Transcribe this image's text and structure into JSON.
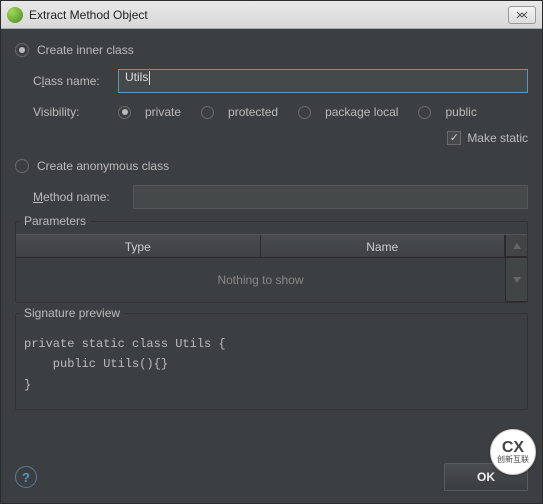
{
  "window": {
    "title": "Extract Method Object"
  },
  "opt_inner": {
    "label": "Create inner class",
    "selected": true
  },
  "class_name": {
    "label_pre": "C",
    "label_ul": "l",
    "label_post": "ass name:",
    "value": "Utils"
  },
  "visibility": {
    "label": "Visibility:",
    "options": [
      {
        "label": "private",
        "underline": "v",
        "selected": true
      },
      {
        "label": "protected",
        "underline": "o",
        "selected": false
      },
      {
        "label": "package local",
        "underline": "",
        "selected": false
      },
      {
        "label": "public",
        "underline": "b",
        "selected": false
      }
    ]
  },
  "make_static": {
    "label": "Make static",
    "checked": true
  },
  "opt_anon": {
    "label": "Create anonymous class",
    "selected": false
  },
  "method_name": {
    "label_pre": "",
    "label_ul": "M",
    "label_post": "ethod name:",
    "value": ""
  },
  "params": {
    "title": "Parameters",
    "col_type": "Type",
    "col_name": "Name",
    "empty": "Nothing to show"
  },
  "sig": {
    "title": "Signature preview",
    "line1": "private static class Utils {",
    "line2": "    public Utils(){}",
    "line3": "}"
  },
  "buttons": {
    "ok": "OK",
    "help": "?"
  },
  "watermark": {
    "brand": "创新互联",
    "letters": "CX"
  }
}
